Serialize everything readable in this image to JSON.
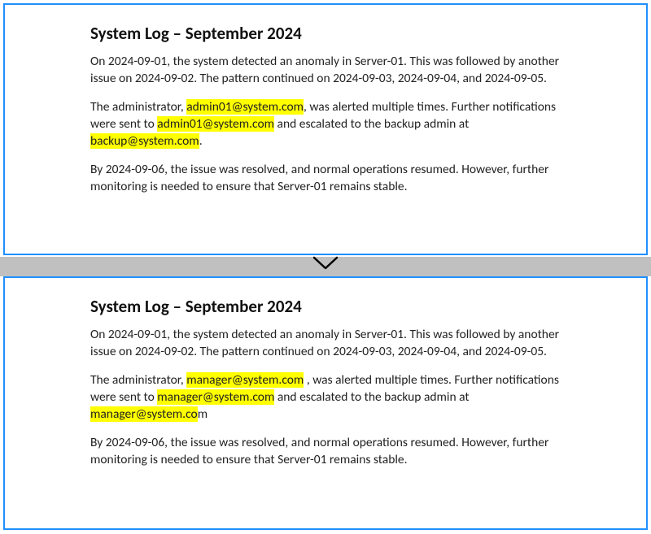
{
  "top": {
    "title": "System Log – September 2024",
    "p1a": "On 2024-09-01, the system detected an anomaly in Server-01. This was followed by another issue on 2024-09-02. The pattern continued on 2024-09-03, 2024-09-04, and 2024-09-05.",
    "p2a": "The administrator, ",
    "p2_hl1": "admin01@system.com",
    "p2b": ", was alerted multiple times. Further notifications were sent to ",
    "p2_hl2": "admin01@system.com",
    "p2c": " and escalated to the backup admin at ",
    "p2_hl3": "backup@system.com",
    "p2d": ".",
    "p3a": "By 2024-09-06, the issue was resolved, and normal operations resumed. However, further monitoring is needed to ensure that Server-01 remains stable."
  },
  "bottom": {
    "title": "System Log – September 2024",
    "p1a": "On 2024-09-01, the system detected an anomaly in Server-01. This was followed by another issue on 2024-09-02. The pattern continued on 2024-09-03, 2024-09-04, and 2024-09-05.",
    "p2a": "The administrator, ",
    "p2_hl1": "manager@system.com",
    "p2b": " , was alerted multiple times. Further notifications were sent to ",
    "p2_hl2": "manager@system.com",
    "p2c": " and escalated to the backup admin at ",
    "p2_hl3": "manager@system.co",
    "p2_tail": "m",
    "p3a": "By 2024-09-06, the issue was resolved, and normal operations resumed. However, further monitoring is needed to ensure that Server-01 remains stable."
  }
}
